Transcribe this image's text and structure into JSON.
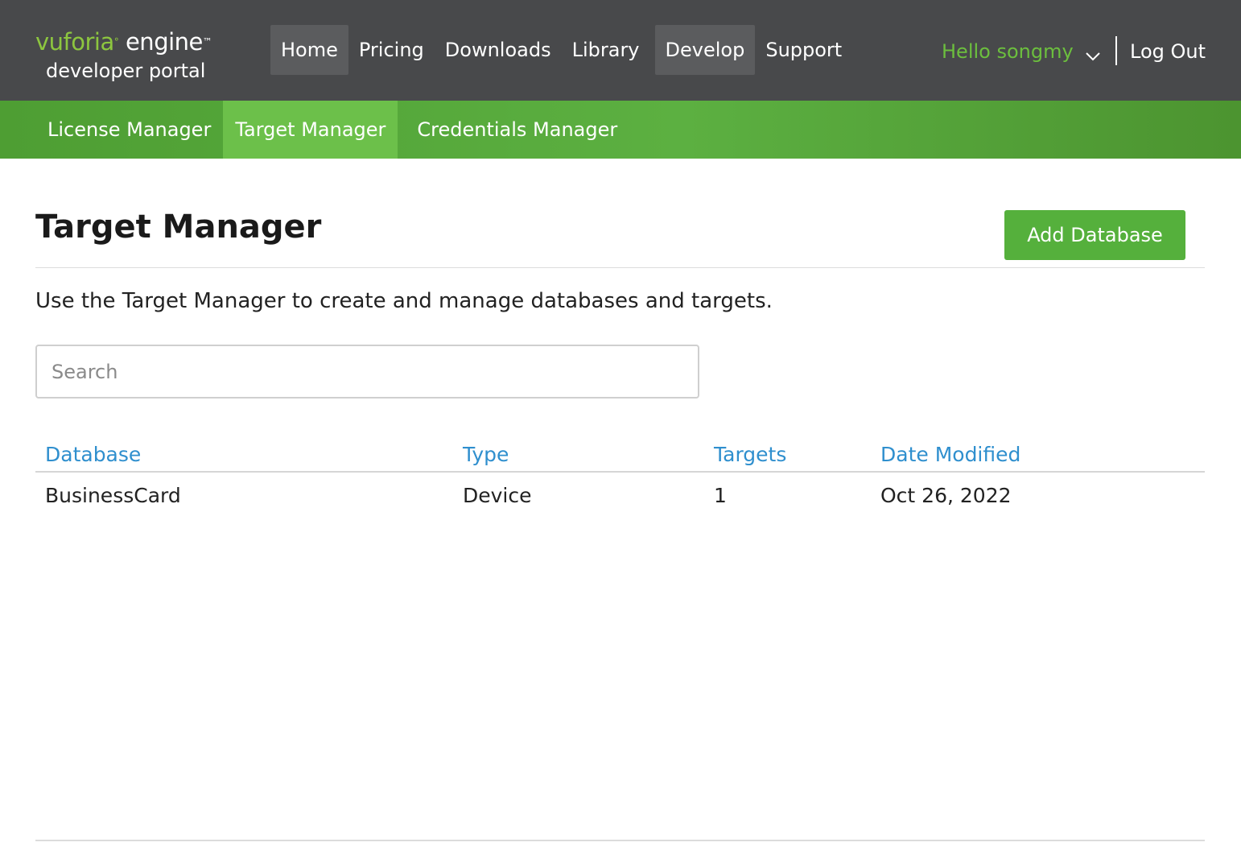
{
  "header": {
    "logo": {
      "brand": "vuforia",
      "product": "engine",
      "subtitle": "developer portal",
      "brand_color": "#8dc63f"
    },
    "nav": [
      {
        "label": "Home",
        "active": true
      },
      {
        "label": "Pricing",
        "active": false
      },
      {
        "label": "Downloads",
        "active": false
      },
      {
        "label": "Library",
        "active": false
      },
      {
        "label": "Develop",
        "active": true
      },
      {
        "label": "Support",
        "active": false
      }
    ],
    "user_greeting": "Hello songmy",
    "user_menu_icon": "chevron-down-icon",
    "logout_label": "Log Out",
    "background_color": "#48494b"
  },
  "sub_nav": {
    "items": [
      {
        "label": "License Manager",
        "active": false
      },
      {
        "label": "Target Manager",
        "active": true
      },
      {
        "label": "Credentials Manager",
        "active": false
      }
    ],
    "background_color": "#5cb041",
    "active_color": "#6cc04a"
  },
  "main": {
    "title": "Target Manager",
    "add_button_label": "Add Database",
    "description": "Use the Target Manager to create and manage databases and targets.",
    "search": {
      "placeholder": "Search",
      "value": ""
    },
    "table": {
      "columns": [
        "Database",
        "Type",
        "Targets",
        "Date Modified"
      ],
      "rows": [
        {
          "database": "BusinessCard",
          "type": "Device",
          "targets": "1",
          "date_modified": "Oct 26, 2022"
        }
      ],
      "header_link_color": "#2f8fce"
    }
  },
  "accent_color": "#55b03c"
}
